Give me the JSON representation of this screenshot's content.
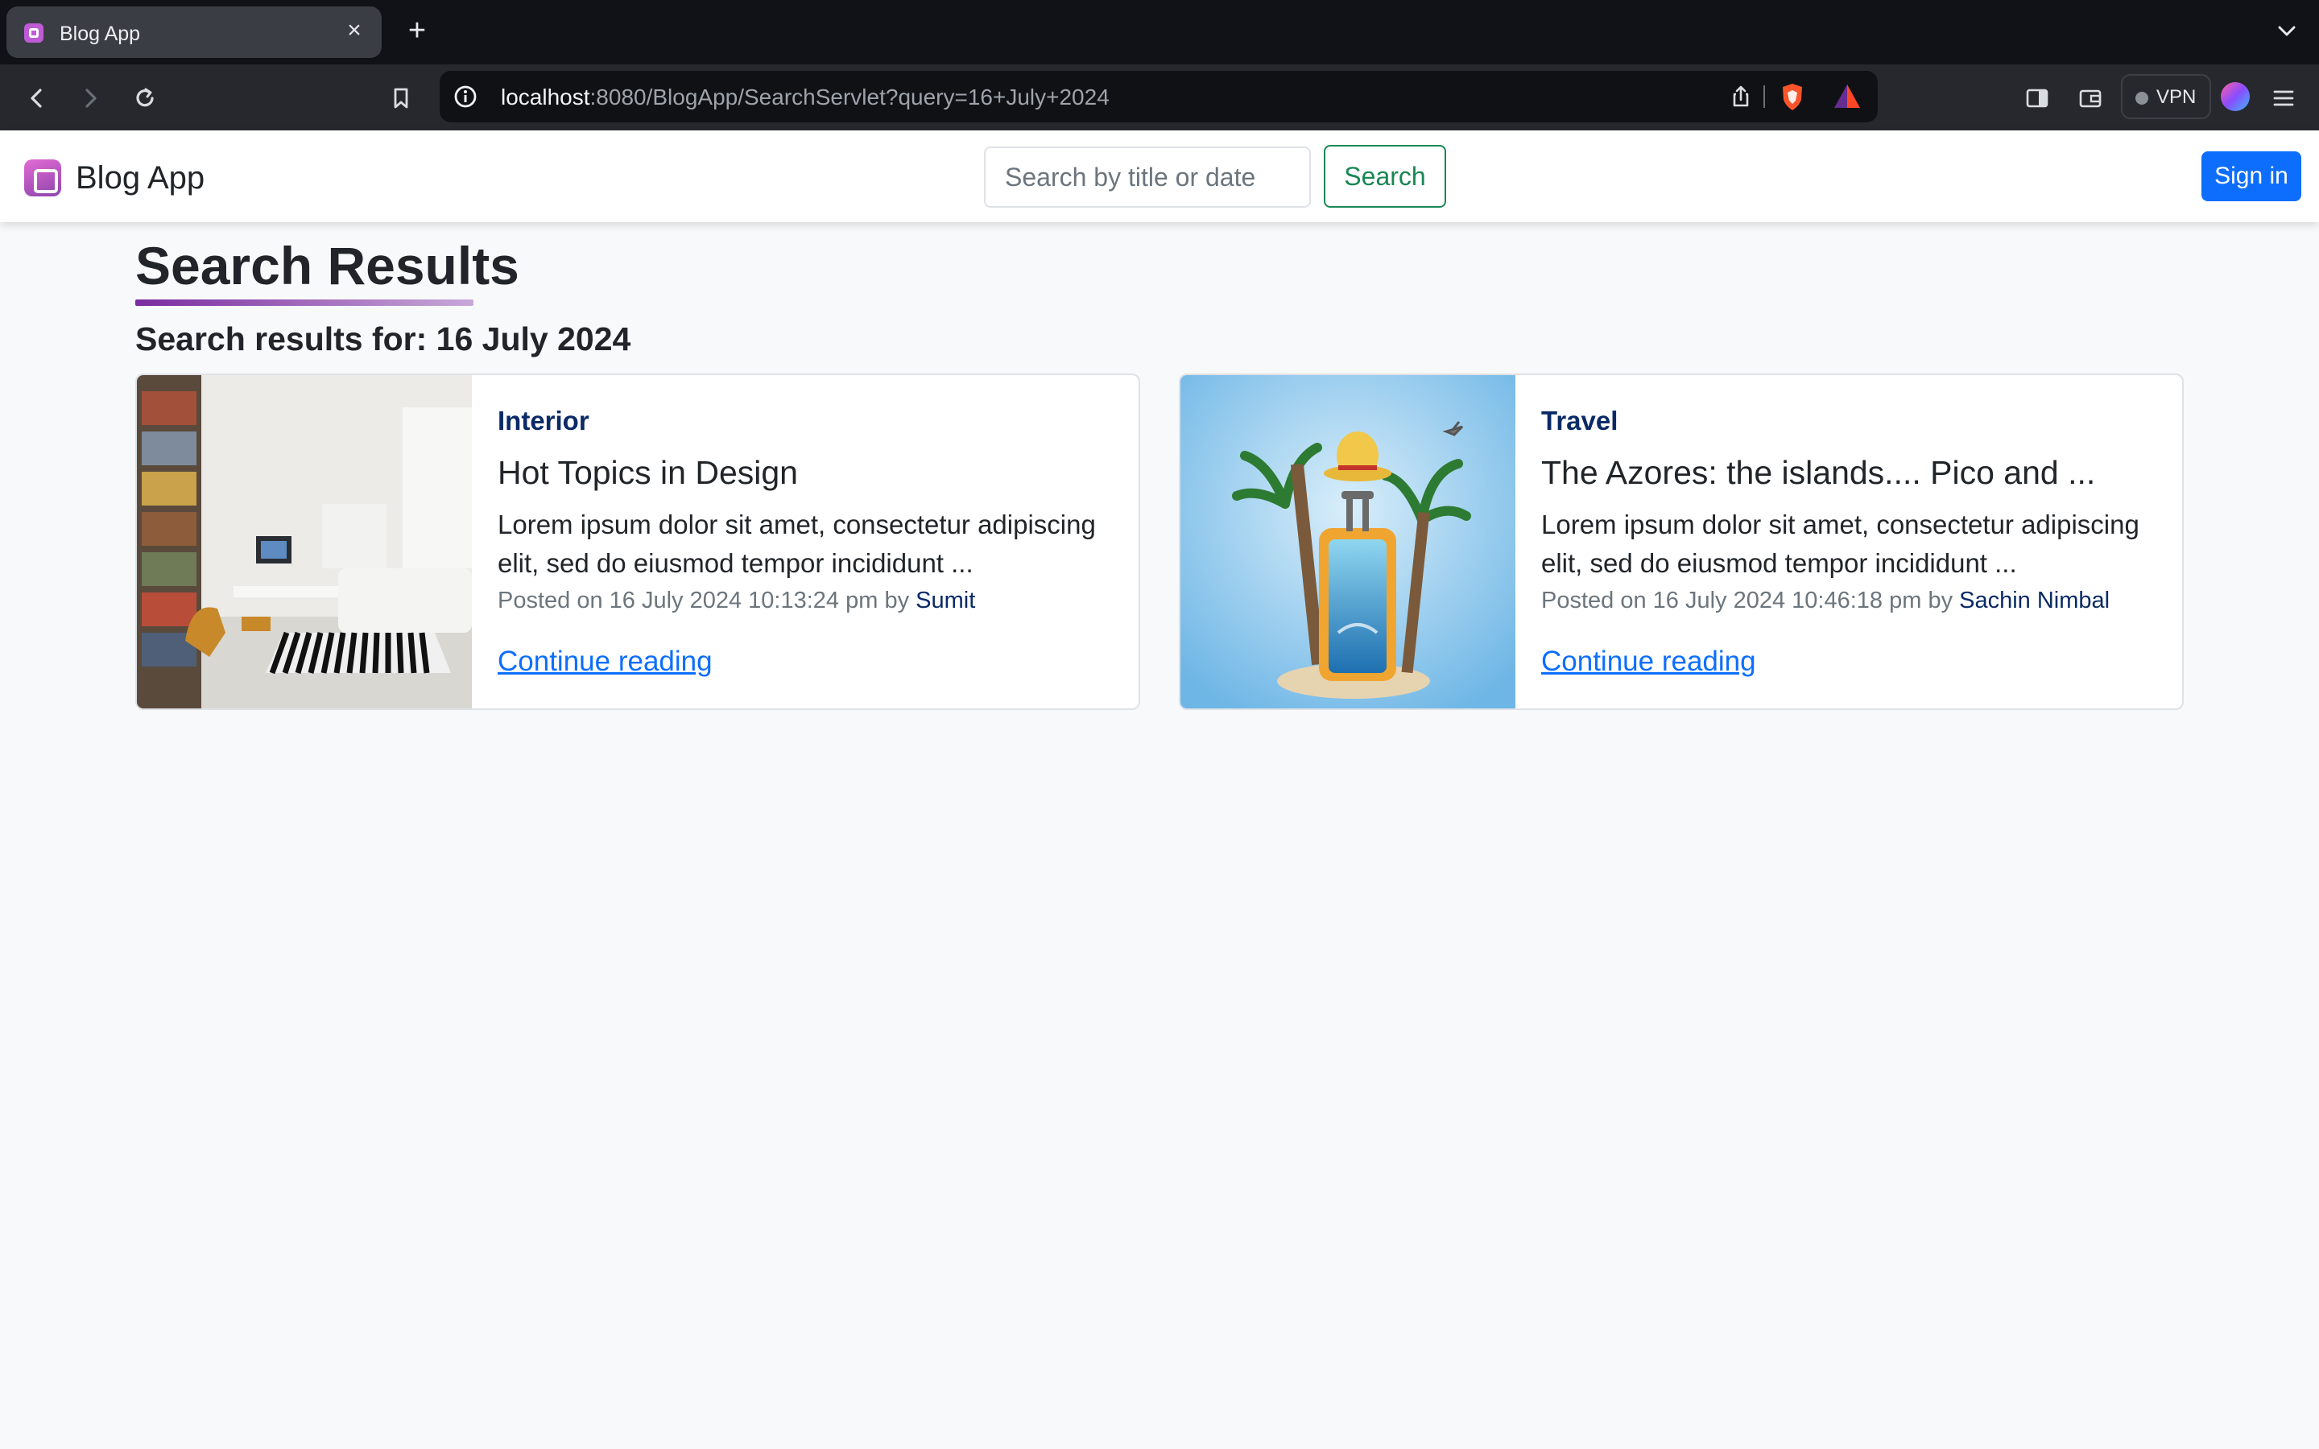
{
  "browser": {
    "tab_title": "Blog App",
    "url_host": "localhost",
    "url_path": ":8080/BlogApp/SearchServlet?query=16+July+2024",
    "vpn_label": "VPN"
  },
  "navbar": {
    "brand": "Blog App",
    "search_placeholder": "Search by title or date",
    "search_button": "Search",
    "signin_button": "Sign in"
  },
  "page": {
    "title": "Search Results",
    "results_for": "Search results for: 16 July 2024"
  },
  "posts": [
    {
      "category": "Interior",
      "title": "Hot Topics in Design",
      "excerpt": "Lorem ipsum dolor sit amet, consectetur adipiscing elit, sed do eiusmod tempor incididunt ...",
      "posted_prefix": "Posted on 16 July 2024 10:13:24 pm by ",
      "author": "Sumit",
      "link": "Continue reading"
    },
    {
      "category": "Travel",
      "title": "The Azores: the islands.... Pico and ...",
      "excerpt": "Lorem ipsum dolor sit amet, consectetur adipiscing elit, sed do eiusmod tempor incididunt ...",
      "posted_prefix": "Posted on 16 July 2024 10:46:18 pm by ",
      "author": "Sachin Nimbal",
      "link": "Continue reading"
    }
  ],
  "colors": {
    "primary": "#0d6efd",
    "success": "#198754",
    "category": "#0a2a66",
    "accent_purple": "#7b2b9f"
  },
  "icons": {
    "tab_favicon": "blogger-icon",
    "brand": "blogger-icon",
    "back": "arrow-left-icon",
    "forward": "arrow-right-icon",
    "reload": "reload-icon",
    "bookmark": "bookmark-icon",
    "site_info": "info-icon",
    "share": "share-icon",
    "shield": "brave-shield-icon",
    "rewards": "brave-rewards-icon",
    "sidebar": "sidebar-icon",
    "wallet": "wallet-icon",
    "menu": "hamburger-menu-icon"
  }
}
